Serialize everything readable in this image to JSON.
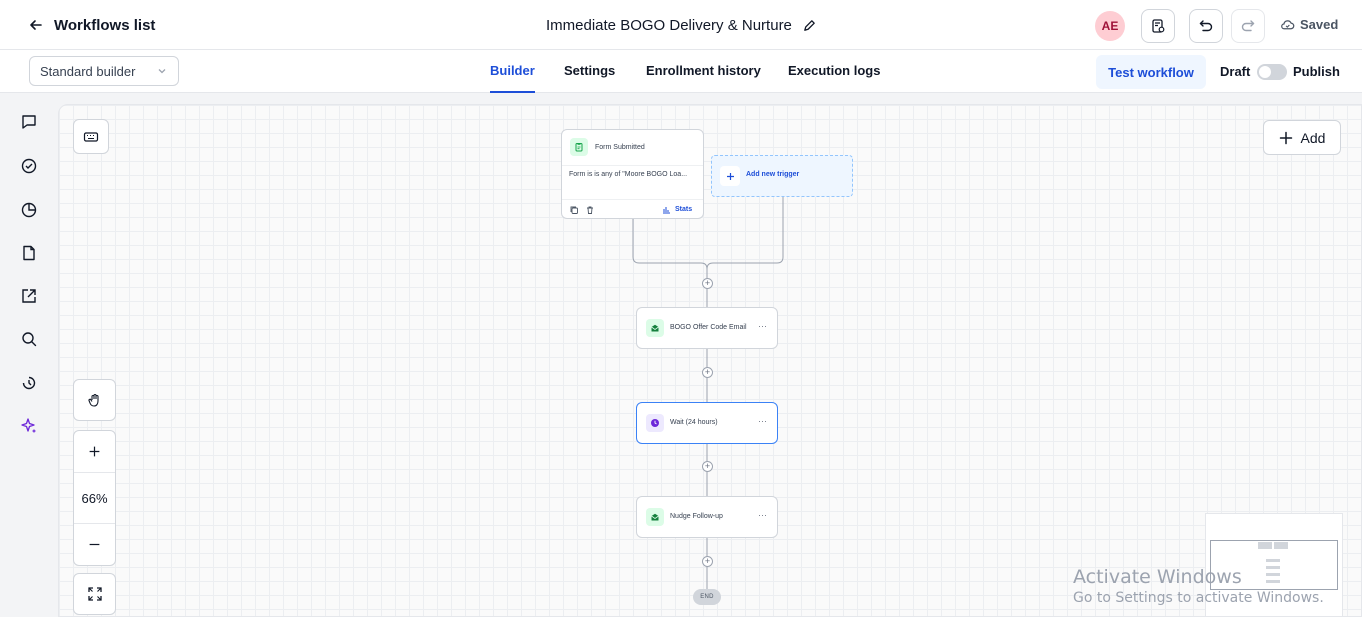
{
  "header": {
    "back_label": "Workflows list",
    "workflow_title": "Immediate BOGO Delivery & Nurture",
    "avatar_initials": "AE",
    "saved_label": "Saved"
  },
  "subbar": {
    "builder_select": "Standard builder",
    "tabs": [
      {
        "label": "Builder",
        "active": true
      },
      {
        "label": "Settings",
        "active": false
      },
      {
        "label": "Enrollment history",
        "active": false
      },
      {
        "label": "Execution logs",
        "active": false
      }
    ],
    "test_workflow": "Test workflow",
    "draft_label": "Draft",
    "publish_label": "Publish",
    "publish_enabled": false
  },
  "rail": {
    "icons": [
      "chat-icon",
      "check-circle-icon",
      "pie-chart-icon",
      "document-icon",
      "external-link-icon",
      "search-icon",
      "history-icon",
      "sparkles-icon"
    ]
  },
  "canvas": {
    "add_label": "Add",
    "zoom_level": "66%",
    "trigger": {
      "title": "Form Submitted",
      "condition": "Form is is any of \"Moore BOGO Loa...",
      "stats_label": "Stats"
    },
    "add_trigger_label": "Add new trigger",
    "actions": [
      {
        "label": "BOGO Offer Code Email",
        "icon": "email-icon",
        "selected": false
      },
      {
        "label": "Wait (24 hours)",
        "icon": "clock-icon",
        "selected": true
      },
      {
        "label": "Nudge Follow-up",
        "icon": "email-icon",
        "selected": false
      }
    ],
    "end_label": "END"
  },
  "watermark": {
    "line1": "Activate Windows",
    "line2": "Go to Settings to activate Windows."
  },
  "colors": {
    "accent": "#1d4ed8",
    "avatar_bg": "#fecdd3",
    "email_badge": "#dcfce7",
    "wait_badge": "#ede9fe"
  }
}
